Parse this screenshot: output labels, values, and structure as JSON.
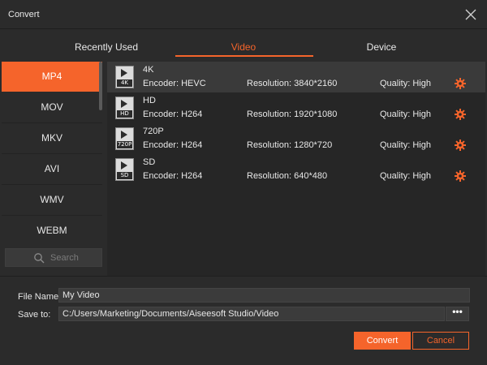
{
  "window": {
    "title": "Convert"
  },
  "tabs": [
    {
      "label": "Recently Used"
    },
    {
      "label": "Video"
    },
    {
      "label": "Device"
    }
  ],
  "active_tab": "Video",
  "formats": [
    {
      "label": "MP4"
    },
    {
      "label": "MOV"
    },
    {
      "label": "MKV"
    },
    {
      "label": "AVI"
    },
    {
      "label": "WMV"
    },
    {
      "label": "WEBM"
    }
  ],
  "active_format": "MP4",
  "search": {
    "placeholder": "Search"
  },
  "presets": [
    {
      "thumb": "4K",
      "title": "4K",
      "encoder": "Encoder: HEVC",
      "resolution": "Resolution: 3840*2160",
      "quality": "Quality: High"
    },
    {
      "thumb": "HD",
      "title": "HD",
      "encoder": "Encoder: H264",
      "resolution": "Resolution: 1920*1080",
      "quality": "Quality: High"
    },
    {
      "thumb": "720P",
      "title": "720P",
      "encoder": "Encoder: H264",
      "resolution": "Resolution: 1280*720",
      "quality": "Quality: High"
    },
    {
      "thumb": "SD",
      "title": "SD",
      "encoder": "Encoder: H264",
      "resolution": "Resolution: 640*480",
      "quality": "Quality: High"
    }
  ],
  "file_name": {
    "label": "File Name:",
    "value": "My Video"
  },
  "save_to": {
    "label": "Save to:",
    "value": "C:/Users/Marketing/Documents/Aiseesoft Studio/Video",
    "browse_label": "•••"
  },
  "buttons": {
    "convert": "Convert",
    "cancel": "Cancel"
  },
  "colors": {
    "accent": "#f5642b",
    "background": "#2b2b2b",
    "list_bg": "#262626"
  }
}
